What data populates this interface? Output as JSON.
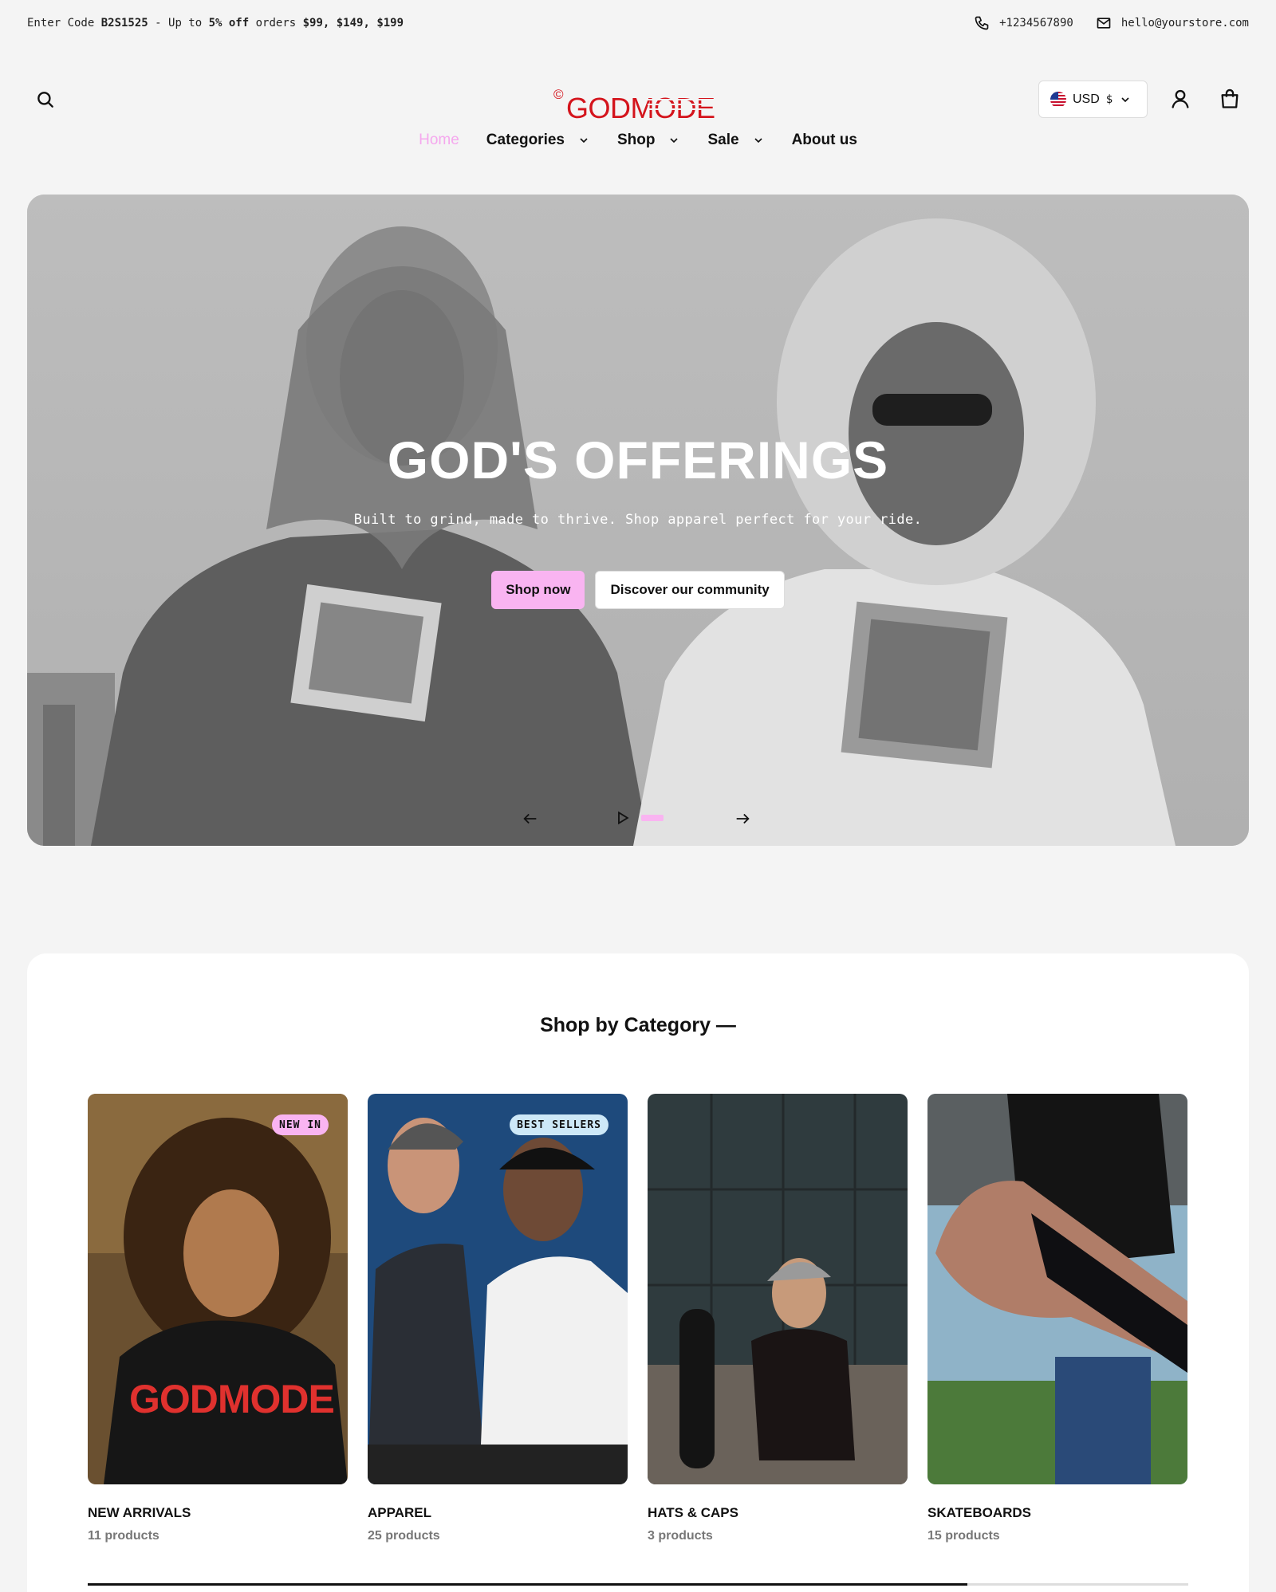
{
  "announcement": {
    "prefix": "Enter Code ",
    "code": "B2S1525",
    "middle": " - Up to ",
    "discount": "5% off",
    "after": " orders ",
    "tiers": "$99, $149, $199"
  },
  "contact": {
    "phone": "+1234567890",
    "email": "hello@yourstore.com",
    "phone_icon": "phone-icon",
    "email_icon": "mail-icon"
  },
  "header": {
    "brand": "GODMODE",
    "brand_mark": "©",
    "currency_code": "USD",
    "currency_symbol": "$"
  },
  "nav": {
    "items": [
      {
        "label": "Home",
        "active": true
      },
      {
        "label": "Categories",
        "dropdown": true
      },
      {
        "label": "Shop",
        "dropdown": true
      },
      {
        "label": "Sale",
        "dropdown": true
      },
      {
        "label": "About us"
      }
    ]
  },
  "hero": {
    "title": "GOD'S OFFERINGS",
    "subtitle": "Built to grind, made to thrive. Shop apparel perfect for your ride.",
    "primary_cta": "Shop now",
    "secondary_cta": "Discover our community",
    "slide_progress": 0.33
  },
  "categories": {
    "heading": "Shop by Category —",
    "items": [
      {
        "title": "NEW ARRIVALS",
        "count": "11 products",
        "badge": "NEW IN",
        "badge_color": "#f9b4f1"
      },
      {
        "title": "APPAREL",
        "count": "25 products",
        "badge": "BEST SELLERS",
        "badge_color": "#cde8f7"
      },
      {
        "title": "HATS & CAPS",
        "count": "3 products",
        "badge": ""
      },
      {
        "title": "SKATEBOARDS",
        "count": "15 products",
        "badge": ""
      }
    ],
    "scroll_progress": 0.8
  },
  "colors": {
    "accent_pink": "#f9b4f1",
    "brand_red": "#d4141c"
  }
}
